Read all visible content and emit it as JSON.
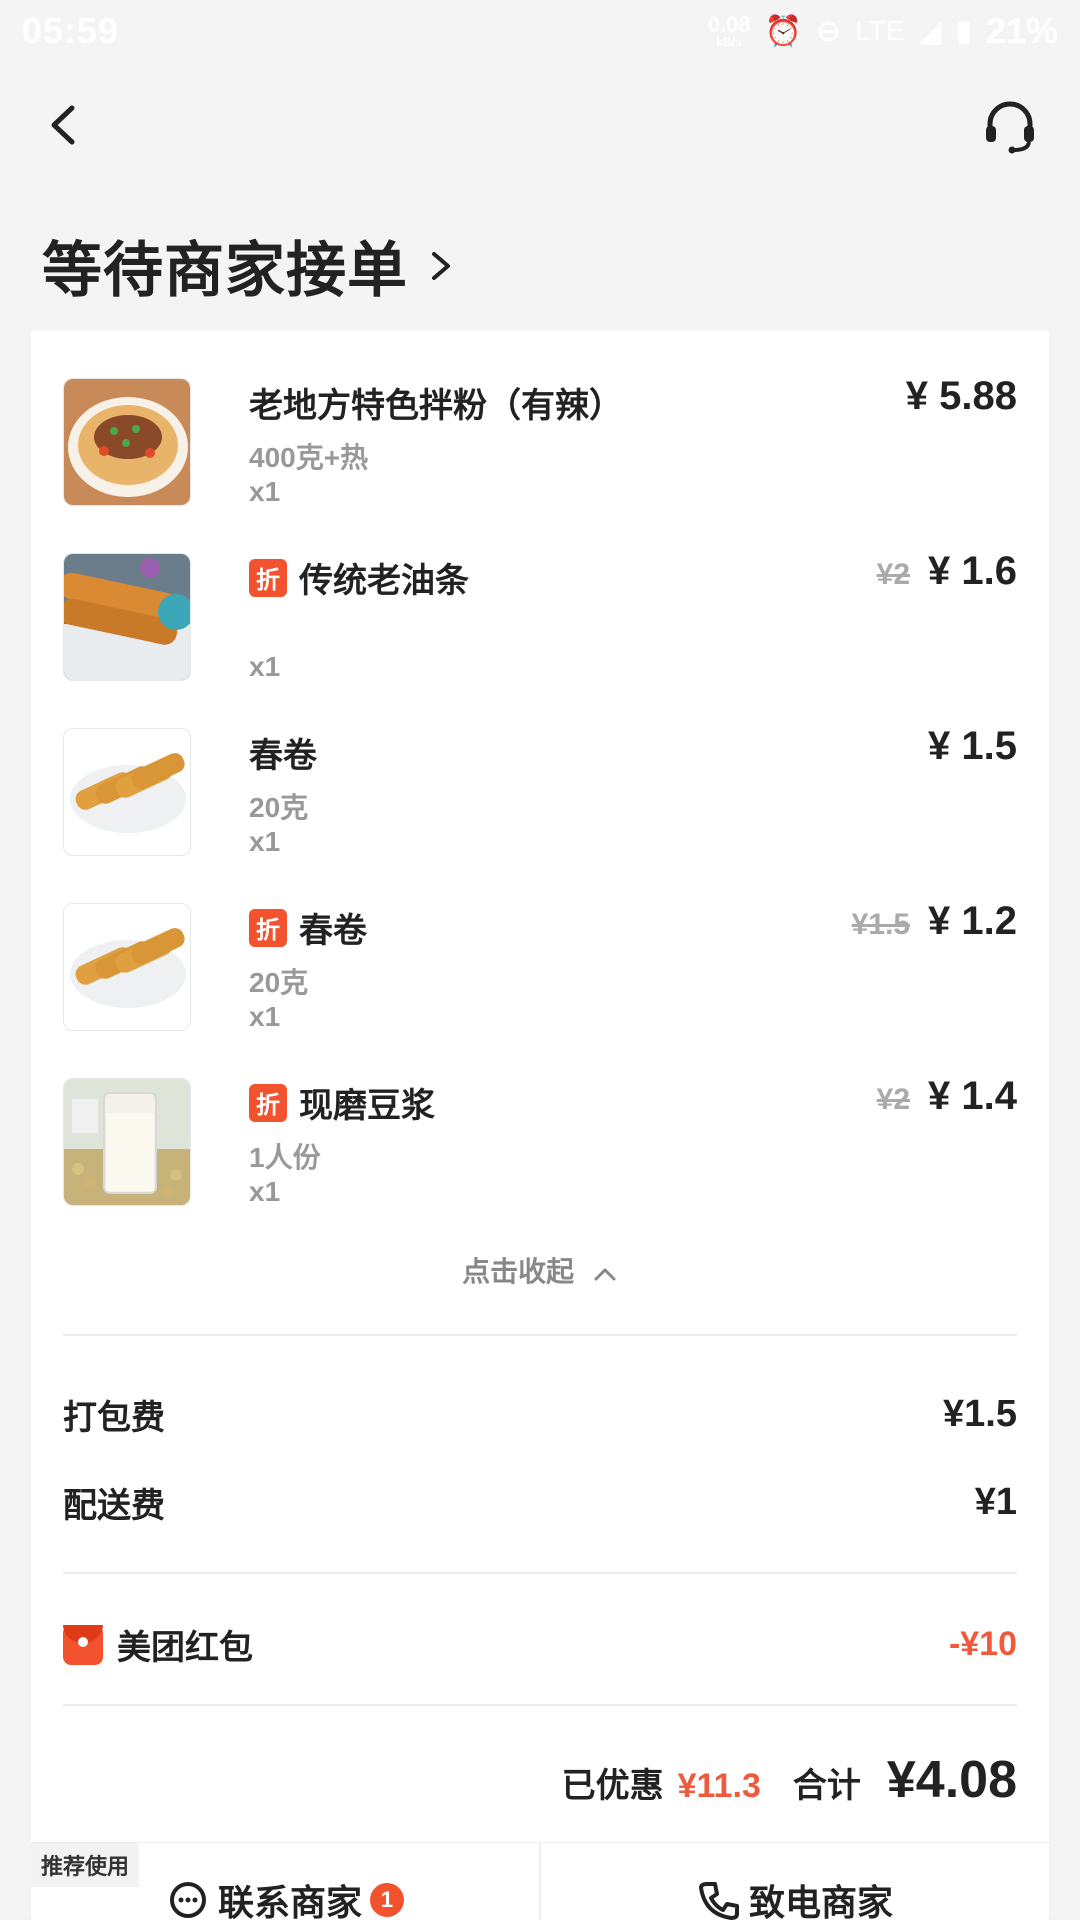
{
  "status_bar": {
    "time": "05:59",
    "net_speed": "0.08",
    "net_unit": "kB/s",
    "network": "LTE",
    "battery": "21%"
  },
  "header": {
    "order_status": "等待商家接单"
  },
  "items": [
    {
      "name": "老地方特色拌粉（有辣）",
      "spec": "400克+热",
      "qty": "x1",
      "price": "¥ 5.88",
      "old_price": null,
      "discount_badge": null,
      "thumb": "noodles-image"
    },
    {
      "name": "传统老油条",
      "spec": "",
      "qty": "x1",
      "price": "¥ 1.6",
      "old_price": "¥2",
      "discount_badge": "折",
      "thumb": "fried-dough-image"
    },
    {
      "name": "春卷",
      "spec": "20克",
      "qty": "x1",
      "price": "¥ 1.5",
      "old_price": null,
      "discount_badge": null,
      "thumb": "spring-roll-image"
    },
    {
      "name": "春卷",
      "spec": "20克",
      "qty": "x1",
      "price": "¥ 1.2",
      "old_price": "¥1.5",
      "discount_badge": "折",
      "thumb": "spring-roll-image"
    },
    {
      "name": "现磨豆浆",
      "spec": "1人份",
      "qty": "x1",
      "price": "¥ 1.4",
      "old_price": "¥2",
      "discount_badge": "折",
      "thumb": "soy-milk-image"
    }
  ],
  "collapse_label": "点击收起",
  "fees": {
    "packing_label": "打包费",
    "packing_value": "¥1.5",
    "delivery_label": "配送费",
    "delivery_value": "¥1"
  },
  "red_packet": {
    "label": "美团红包",
    "value": "-¥10"
  },
  "summary": {
    "saved_label": "已优惠",
    "saved_value": "¥11.3",
    "total_label": "合计",
    "total_value": "¥4.08"
  },
  "bottom": {
    "recommend_tag": "推荐使用",
    "contact_label": "联系商家",
    "contact_badge": "1",
    "call_label": "致电商家"
  },
  "colors": {
    "accent": "#f2522e",
    "discount_text": "#f05a3c"
  }
}
